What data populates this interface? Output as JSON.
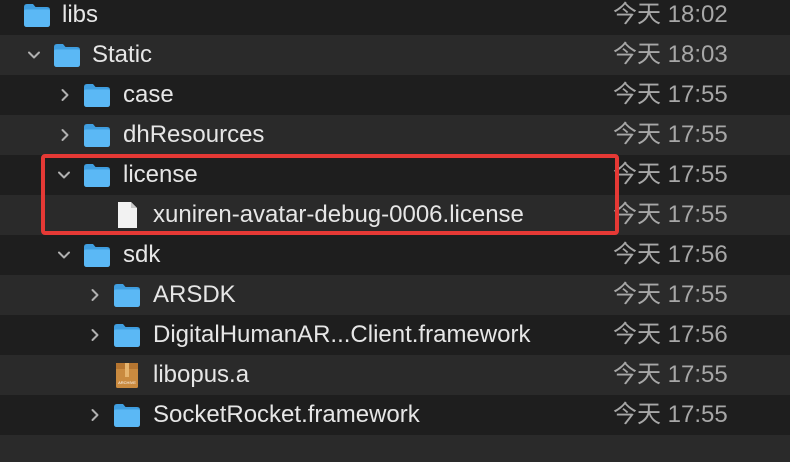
{
  "rows": [
    {
      "name": "libs",
      "date": "今天 18:02",
      "kind": "folder",
      "expanded": true
    },
    {
      "name": "Static",
      "date": "今天 18:03",
      "kind": "folder",
      "expanded": true
    },
    {
      "name": "case",
      "date": "今天 17:55",
      "kind": "folder",
      "expanded": false
    },
    {
      "name": "dhResources",
      "date": "今天 17:55",
      "kind": "folder",
      "expanded": false
    },
    {
      "name": "license",
      "date": "今天 17:55",
      "kind": "folder",
      "expanded": true
    },
    {
      "name": "xuniren-avatar-debug-0006.license",
      "date": "今天 17:55",
      "kind": "file"
    },
    {
      "name": "sdk",
      "date": "今天 17:56",
      "kind": "folder",
      "expanded": true
    },
    {
      "name": "ARSDK",
      "date": "今天 17:55",
      "kind": "folder",
      "expanded": false
    },
    {
      "name": "DigitalHumanAR...Client.framework",
      "date": "今天 17:56",
      "kind": "folder",
      "expanded": false
    },
    {
      "name": "libopus.a",
      "date": "今天 17:55",
      "kind": "archive"
    },
    {
      "name": "SocketRocket.framework",
      "date": "今天 17:55",
      "kind": "folder",
      "expanded": false
    }
  ],
  "archive_icon_label": "ARCHIVE",
  "colors": {
    "background": "#1e1e1e",
    "row_alt": "#2a2a2a",
    "folder_blue": "#5bb8f5",
    "highlight": "#e53935",
    "text": "#e6e6e6",
    "date_text": "#a7a7a7"
  }
}
